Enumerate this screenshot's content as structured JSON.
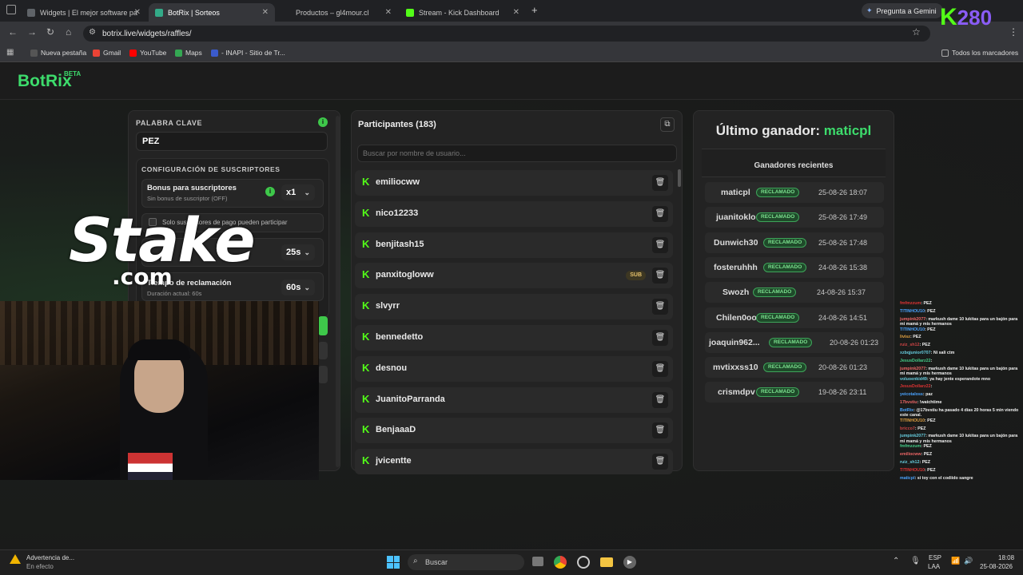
{
  "browser": {
    "tabs": [
      {
        "label": "Widgets | El mejor software pa",
        "active": false
      },
      {
        "label": "BotRix | Sorteos",
        "active": true
      },
      {
        "label": "Productos – gl4mour.cl",
        "active": false
      },
      {
        "label": "Stream - Kick Dashboard",
        "active": false
      }
    ],
    "new_tab": "+",
    "gemini_label": "Pregunta a Gemini",
    "url": "botrix.live/widgets/raffles/",
    "bookmarks": [
      "Nueva pestaña",
      "Gmail",
      "YouTube",
      "Maps",
      "- INAPI - Sitio de Tr...",
      "Todos los marcadores"
    ]
  },
  "overlay": {
    "kick_logo": "K",
    "kick_number": "280",
    "sponsor": "Stake",
    "sponsor_domain": ".com"
  },
  "app": {
    "logo": "BotRix",
    "logo_badge": "BETA"
  },
  "settings": {
    "keyword_label": "PALABRA CLAVE",
    "keyword_value": "PEZ",
    "subs_section": "CONFIGURACIÓN DE SUSCRIPTORES",
    "bonus_title": "Bonus para suscriptores",
    "bonus_subtitle": "Sin bonus de suscriptor (OFF)",
    "bonus_value": "x1",
    "subs_only_label": "Solo suscriptores de pago pueden participar",
    "timer_value": "25s",
    "claim_title": "Tiempo de reclamación",
    "claim_subtitle": "Duración actual: 60s",
    "claim_value": "60s"
  },
  "participants": {
    "title": "Participantes (183)",
    "search_placeholder": "Buscar por nombre de usuario...",
    "sub_badge": "SUB",
    "list": [
      {
        "name": "emiliocww",
        "sub": false
      },
      {
        "name": "nico12233",
        "sub": false
      },
      {
        "name": "benjitash15",
        "sub": false
      },
      {
        "name": "panxitogloww",
        "sub": true
      },
      {
        "name": "slvyrr",
        "sub": false
      },
      {
        "name": "bennedetto",
        "sub": false
      },
      {
        "name": "desnou",
        "sub": false
      },
      {
        "name": "JuanitoParranda",
        "sub": false
      },
      {
        "name": "BenjaaaD",
        "sub": false
      },
      {
        "name": "jvicentte",
        "sub": false
      }
    ]
  },
  "winners": {
    "last_label": "Último ganador:",
    "last_name": "maticpl",
    "recent_title": "Ganadores recientes",
    "status": "RECLAMADO",
    "list": [
      {
        "name": "maticpl",
        "date": "25-08-26 18:07"
      },
      {
        "name": "juanitoklo",
        "date": "25-08-26 17:49"
      },
      {
        "name": "Dunwich30",
        "date": "25-08-26 17:48"
      },
      {
        "name": "fosteruhhh",
        "date": "24-08-26 15:38"
      },
      {
        "name": "Swozh",
        "date": "24-08-26 15:37"
      },
      {
        "name": "Chilen0oo",
        "date": "24-08-26 14:51"
      },
      {
        "name": "joaquin962...",
        "date": "20-08-26 01:23"
      },
      {
        "name": "mvtixxss10",
        "date": "20-08-26 01:23"
      },
      {
        "name": "crismdpv",
        "date": "19-08-26 23:11"
      }
    ]
  },
  "chat": [
    {
      "user": "fmfmzzum",
      "msg": "PEZ"
    },
    {
      "user": "TITINHOU10",
      "msg": "PEZ"
    },
    {
      "user": "jumpink2077",
      "msg": "markush dame 10 lukitas para un bajón para mi mamá y mis hermanos"
    },
    {
      "user": "TITINHOU10",
      "msg": "PEZ"
    },
    {
      "user": "livisz",
      "msg": "PEZ"
    },
    {
      "user": "ruiz_sh12",
      "msg": "PEZ"
    },
    {
      "user": "xzbqjunior0707",
      "msg": "Ni sali ctm"
    },
    {
      "user": "JesusDollarz22",
      "msg": ""
    },
    {
      "user": "jumpink2077",
      "msg": "markush dame 10 lukitas para un bajón para mi mamá y mis hermanos"
    },
    {
      "user": "voluoenkid49",
      "msg": "ya hay jente esperandote mno"
    },
    {
      "user": "JesusDollarz22",
      "msg": ""
    },
    {
      "user": "yeicotaloss",
      "msg": "paz"
    },
    {
      "user": "17bvstiu",
      "msg": "!watchtime"
    },
    {
      "user": "BotRix",
      "msg": "@17bvstiu ha pasado 4 días 20 horas 5 min viendo este canal."
    },
    {
      "user": "TITINHOU10",
      "msg": "PEZ"
    },
    {
      "user": "bricco7",
      "msg": "PEZ"
    },
    {
      "user": "jumpink2077",
      "msg": "markush dame 10 lukitas para un bajón para mi mamá y mis hermanos"
    },
    {
      "user": "fmfmzzum",
      "msg": "PEZ"
    },
    {
      "user": "emiliocww",
      "msg": "PEZ"
    },
    {
      "user": "ruiz_sh12",
      "msg": "PEZ"
    },
    {
      "user": "TITINHOU10",
      "msg": "PEZ"
    },
    {
      "user": "maticpl",
      "msg": "si toy con el codiido sangre"
    }
  ],
  "taskbar": {
    "notice_title": "Advertencia de...",
    "notice_sub": "En efecto",
    "search": "Buscar",
    "lang": "ESP",
    "lang_sub": "LAA",
    "time": "18:08",
    "date": "25-08-2026"
  }
}
